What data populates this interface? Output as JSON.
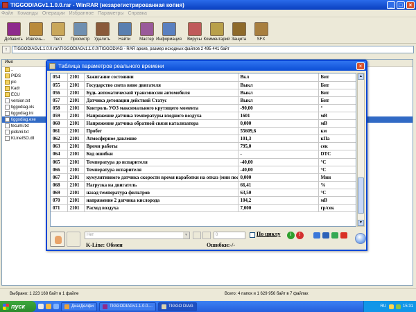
{
  "winrar": {
    "title": "TIGGODIAGv1.1.0.0.rar - WinRAR (незарегистрированная копия)",
    "menu": [
      "Файл",
      "Команды",
      "Операции",
      "Избранное",
      "Параметры",
      "Справка"
    ],
    "toolbar": [
      {
        "label": "Добавить",
        "icon": "add-archive-icon",
        "color": "#8E2A8C"
      },
      {
        "label": "Извлечь...",
        "icon": "extract-icon",
        "color": "#B98A3A"
      },
      {
        "label": "Тест",
        "icon": "test-icon",
        "color": "#C9A75A"
      },
      {
        "label": "Просмотр",
        "icon": "view-icon",
        "color": "#6F8FB0"
      },
      {
        "label": "Удалить",
        "icon": "delete-icon",
        "color": "#8A5A3A"
      },
      {
        "label": "Найти",
        "icon": "find-icon",
        "color": "#5A7FB0"
      },
      {
        "label": "Мастер",
        "icon": "wizard-icon",
        "color": "#9A5A9A"
      },
      {
        "label": "Информация",
        "icon": "info-icon",
        "color": "#5A80C0"
      },
      {
        "label": "Вирусы",
        "icon": "virus-icon",
        "color": "#C05A5A"
      },
      {
        "label": "Комментарий",
        "icon": "comment-icon",
        "color": "#B9A04A"
      },
      {
        "label": "Защита",
        "icon": "protect-icon",
        "color": "#8E6A2A"
      },
      {
        "label": "SFX",
        "icon": "sfx-icon",
        "color": "#A87F3F"
      }
    ],
    "path": "TIGGODIAGv1.1.0.0.rar\\TIGGODIAGv1.1.0.0\\TIGGODIAG - RAR архив, размер исходных файлов 2 495 441 байт",
    "list_header": "Имя",
    "files": [
      {
        "name": "..",
        "type": "folder"
      },
      {
        "name": "PIDS",
        "type": "folder"
      },
      {
        "name": "pic",
        "type": "folder"
      },
      {
        "name": "Kadr",
        "type": "folder"
      },
      {
        "name": "ECU",
        "type": "folder"
      },
      {
        "name": "version.txt",
        "type": "file"
      },
      {
        "name": "tiggodiag.xls",
        "type": "file"
      },
      {
        "name": "tiggodiag.ini",
        "type": "file"
      },
      {
        "name": "tiggodiag.exe",
        "type": "file",
        "selected": true
      },
      {
        "name": "tecumi.txt",
        "type": "file"
      },
      {
        "name": "pidsmi.txt",
        "type": "file"
      },
      {
        "name": "KLineISO.dll",
        "type": "file"
      }
    ],
    "status_left": "Выбрано: 1 223 168 байт в 1 файле",
    "status_right": "Всего: 4 папок и 1 629 956 байт в 7 файлах"
  },
  "dialog": {
    "title": "Таблица параметров реального времени",
    "rows": [
      [
        "054",
        "2101",
        "Зажигание состоянии",
        "Вкл",
        "Бит"
      ],
      [
        "055",
        "2101",
        "Государство света вине двигателя",
        "Выкл",
        "Бит"
      ],
      [
        "056",
        "2101",
        "Будь автоматической трансмиссии автомобиля",
        "Выкл",
        "Бит"
      ],
      [
        "057",
        "2101",
        "Датчика детонации действий Статус",
        "Выкл",
        "Бит"
      ],
      [
        "058",
        "2101",
        "Контроль УОЗ максимального крутящего момента",
        "-90,00",
        "°"
      ],
      [
        "059",
        "2101",
        "Напряжение датчика температуры входного воздуха",
        "1601",
        "мВ"
      ],
      [
        "060",
        "2101",
        "Напряжение датчика обратной связи катализатора",
        "0,000",
        "мВ"
      ],
      [
        "061",
        "2101",
        "Пробег",
        "55609,6",
        "км"
      ],
      [
        "062",
        "2101",
        "Атмосферное давление",
        "101,3",
        "кПа"
      ],
      [
        "063",
        "2101",
        "Время работы",
        "795,0",
        "сек"
      ],
      [
        "064",
        "2101",
        "Код ошибки",
        "-",
        "DTC"
      ],
      [
        "065",
        "2101",
        "Температура до испарителя",
        "-40,00",
        "°C"
      ],
      [
        "066",
        "2101",
        "Температура испарителя",
        "-40,00",
        "°C"
      ],
      [
        "067",
        "2101",
        "кумулятивного датчика скорости время наработки на отказ (мин пос",
        "0,000",
        "Мин"
      ],
      [
        "068",
        "2101",
        "Нагрузка на двигатель",
        "66,41",
        "%"
      ],
      [
        "069",
        "2101",
        "назад температура фильтров",
        "63,50",
        "°C"
      ],
      [
        "070",
        "2101",
        "напряжение 2 датчика кислорода",
        "104,2",
        "мВ"
      ],
      [
        "071",
        "2101",
        "Расход воздуха",
        "7,000",
        "гр/сек"
      ]
    ],
    "combo_placeholder": "Нет",
    "cycle_label": "По циклу",
    "kline_label": "K-Line: Обмен",
    "errors_label": "Ошибки:-/-"
  },
  "taskbar": {
    "start_label": "пуск",
    "tasks": [
      {
        "label": "ДиагДелфи",
        "icon_color": "#E9A23B"
      },
      {
        "label": "TIGGODIAGv1.1.0.0....",
        "icon_color": "#8E2A8C"
      },
      {
        "label": "TIGGO DIAG",
        "icon_color": "#D9D2B0",
        "active": true
      }
    ],
    "lang": "RU",
    "clock": "15:31"
  }
}
